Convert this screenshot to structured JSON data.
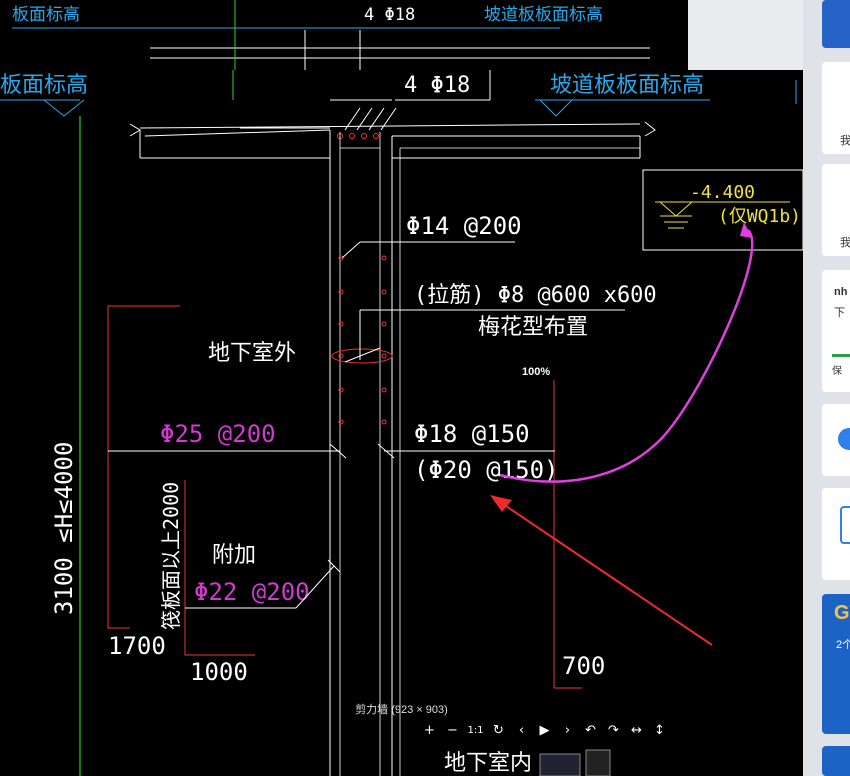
{
  "viewer": {
    "zoom": "100%",
    "caption": "剪力墙 (923 × 903)",
    "toolbar": [
      "+",
      "−",
      "1:1",
      "↻",
      "‹",
      "▶",
      "›",
      "↶",
      "↷",
      "↔",
      "↕"
    ]
  },
  "background_strip": {
    "left_label": "板面标高",
    "bar_label": "4 Φ18",
    "slab_label": "坡道板板面标高"
  },
  "drawing": {
    "top_left_label": "板面标高",
    "top_bar": "4 Φ18",
    "top_right_label": "坡道板板面标高",
    "elevation": "-4.400",
    "elevation_note": "(仅WQ1b)",
    "horiz_bar": "Φ14 @200",
    "tie_bar_1": "(拉筋)  Φ8 @600 x600",
    "tie_bar_2": "梅花型布置",
    "outside_label": "地下室外",
    "outer_vertical": "Φ25 @200",
    "inner_vertical_1": "Φ18 @150",
    "inner_vertical_2": "(Φ20 @150)",
    "height_range": "3100 ≤H≤4000",
    "raft_label": "筏板面以上2000",
    "additional_label": "附加",
    "additional_bar": "Φ22 @200",
    "dim_1700": "1700",
    "dim_1000": "1000",
    "dim_700": "700",
    "inside_label": "地下室内"
  },
  "right_panel": {
    "texts": [
      "我",
      "我",
      "nh",
      "下",
      "保"
    ],
    "badge": "GT",
    "badge_sub": "2个"
  }
}
